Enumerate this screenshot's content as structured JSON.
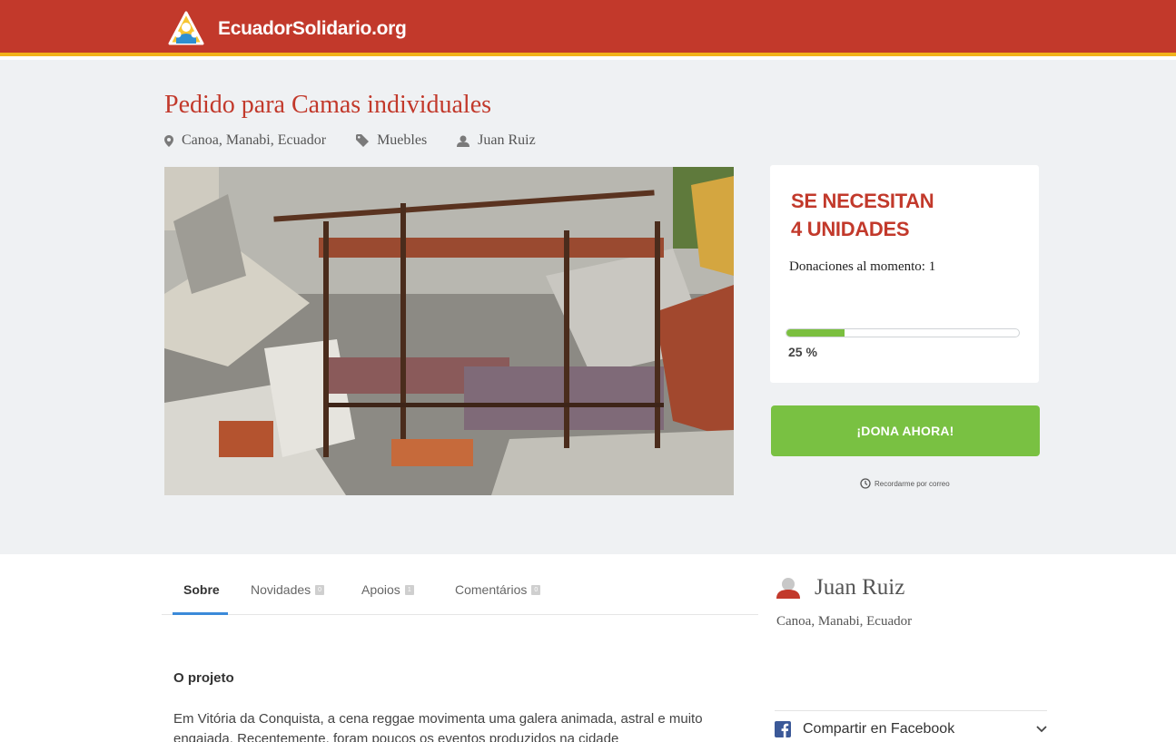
{
  "header": {
    "site_name": "EcuadorSolidario.org",
    "logo_icon": "ecuador-solidario-logo",
    "bar_color": "#c2392b",
    "accent_color": "#f2b21b"
  },
  "request": {
    "title": "Pedido para Camas individuales",
    "location": "Canoa, Manabi, Ecuador",
    "category": "Muebles",
    "author": "Juan Ruiz",
    "image_icon": "earthquake-rubble-photo"
  },
  "need": {
    "line1": "SE NECESITAN",
    "line2": "4 UNIDADES",
    "donations_text": "Donaciones al momento: 1",
    "progress": 0.25,
    "progress_label": "25 %",
    "progress_color": "#7bbf3f"
  },
  "actions": {
    "donate_label": "¡DONA AHORA!",
    "donate_color": "#79c142",
    "remind_label": "Recordarme por correo"
  },
  "tabs": [
    {
      "label": "Sobre",
      "badge": ""
    },
    {
      "label": "Novidades",
      "badge": "0"
    },
    {
      "label": "Apoios",
      "badge": "1"
    },
    {
      "label": "Comentários",
      "badge": "0"
    }
  ],
  "content": {
    "heading": "O projeto",
    "paragraph": "Em Vitória da Conquista, a cena reggae movimenta uma galera animada, astral e muito engajada. Recentemente, foram poucos os eventos produzidos na cidade"
  },
  "sidebar": {
    "author_name": "Juan Ruiz",
    "author_location": "Canoa, Manabi, Ecuador",
    "share_label": "Compartir en Facebook"
  }
}
